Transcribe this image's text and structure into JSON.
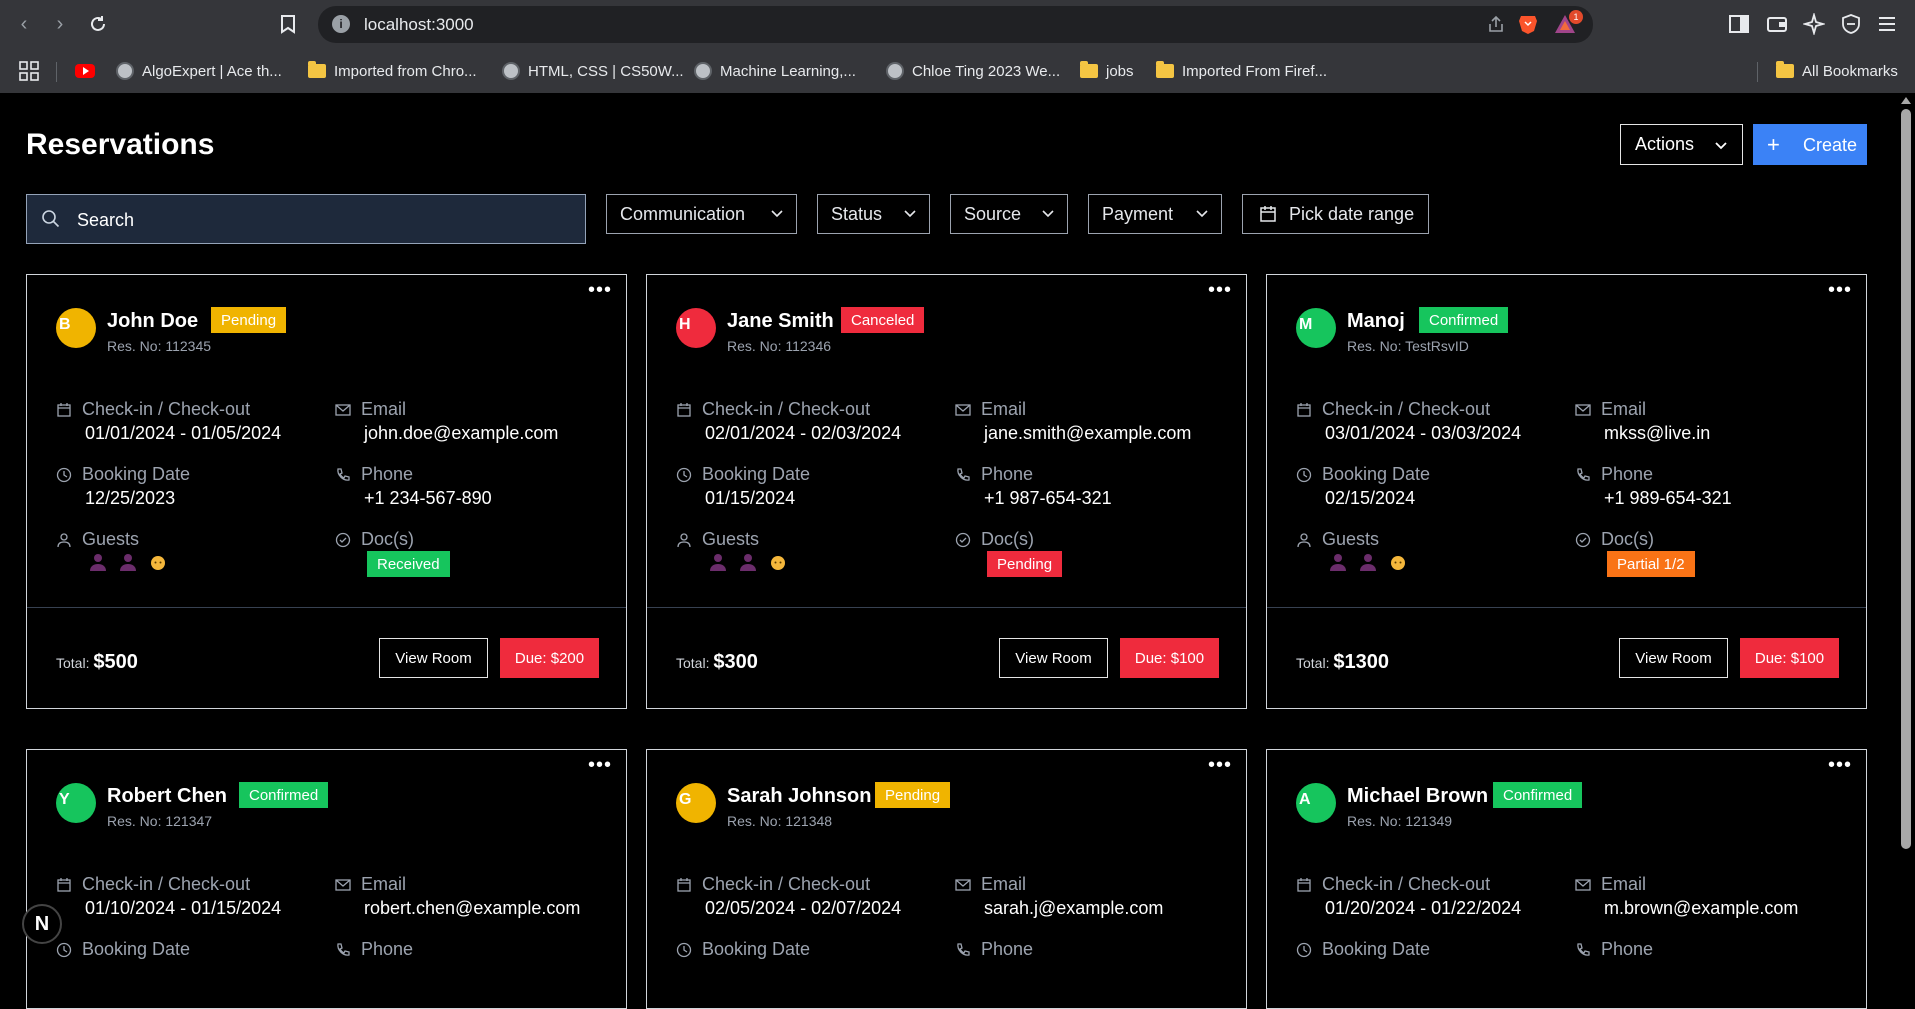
{
  "browser": {
    "url": "localhost:3000",
    "notification_count": "1",
    "bookmarks": [
      {
        "label": "AlgoExpert | Ace th...",
        "icon": "globe"
      },
      {
        "label": "Imported from Chro...",
        "icon": "folder"
      },
      {
        "label": "HTML, CSS | CS50W...",
        "icon": "globe"
      },
      {
        "label": "Machine Learning,...",
        "icon": "globe"
      },
      {
        "label": "Chloe Ting 2023 We...",
        "icon": "globe"
      },
      {
        "label": "jobs",
        "icon": "folder"
      },
      {
        "label": "Imported From Firef...",
        "icon": "folder"
      }
    ],
    "all_bookmarks": "All Bookmarks"
  },
  "header": {
    "title": "Reservations",
    "actions_label": "Actions",
    "create_label": "Create"
  },
  "filters": {
    "search_placeholder": "Search",
    "communication": "Communication",
    "status": "Status",
    "source": "Source",
    "payment": "Payment",
    "date_range": "Pick date range"
  },
  "labels": {
    "checkin": "Check-in / Check-out",
    "email": "Email",
    "booking_date": "Booking Date",
    "phone": "Phone",
    "guests": "Guests",
    "docs": "Doc(s)",
    "total": "Total:",
    "view_room": "View Room"
  },
  "colors": {
    "pending": "#f0b400",
    "canceled": "#ef2b3d",
    "confirmed": "#16c55d",
    "partial": "#f97316",
    "create": "#3b82f6"
  },
  "reservations": [
    {
      "initial": "B",
      "name": "John Doe",
      "status": "Pending",
      "res_no": "Res. No: 112345",
      "dates": "01/01/2024 - 01/05/2024",
      "email": "john.doe@example.com",
      "booking_date": "12/25/2023",
      "phone": "+1 234-567-890",
      "docs": "Received",
      "total": "$500",
      "due": "Due: $200"
    },
    {
      "initial": "H",
      "name": "Jane Smith",
      "status": "Canceled",
      "res_no": "Res. No: 112346",
      "dates": "02/01/2024 - 02/03/2024",
      "email": "jane.smith@example.com",
      "booking_date": "01/15/2024",
      "phone": "+1 987-654-321",
      "docs": "Pending",
      "total": "$300",
      "due": "Due: $100"
    },
    {
      "initial": "M",
      "name": "Manoj",
      "status": "Confirmed",
      "res_no": "Res. No: TestRsvID",
      "dates": "03/01/2024 - 03/03/2024",
      "email": "mkss@live.in",
      "booking_date": "02/15/2024",
      "phone": "+1 989-654-321",
      "docs": "Partial 1/2",
      "total": "$1300",
      "due": "Due: $100"
    },
    {
      "initial": "Y",
      "name": "Robert Chen",
      "status": "Confirmed",
      "res_no": "Res. No: 121347",
      "dates": "01/10/2024 - 01/15/2024",
      "email": "robert.chen@example.com"
    },
    {
      "initial": "G",
      "name": "Sarah Johnson",
      "status": "Pending",
      "res_no": "Res. No: 121348",
      "dates": "02/05/2024 - 02/07/2024",
      "email": "sarah.j@example.com"
    },
    {
      "initial": "A",
      "name": "Michael Brown",
      "status": "Confirmed",
      "res_no": "Res. No: 121349",
      "dates": "01/20/2024 - 01/22/2024",
      "email": "m.brown@example.com"
    }
  ],
  "dev_badge": "N"
}
